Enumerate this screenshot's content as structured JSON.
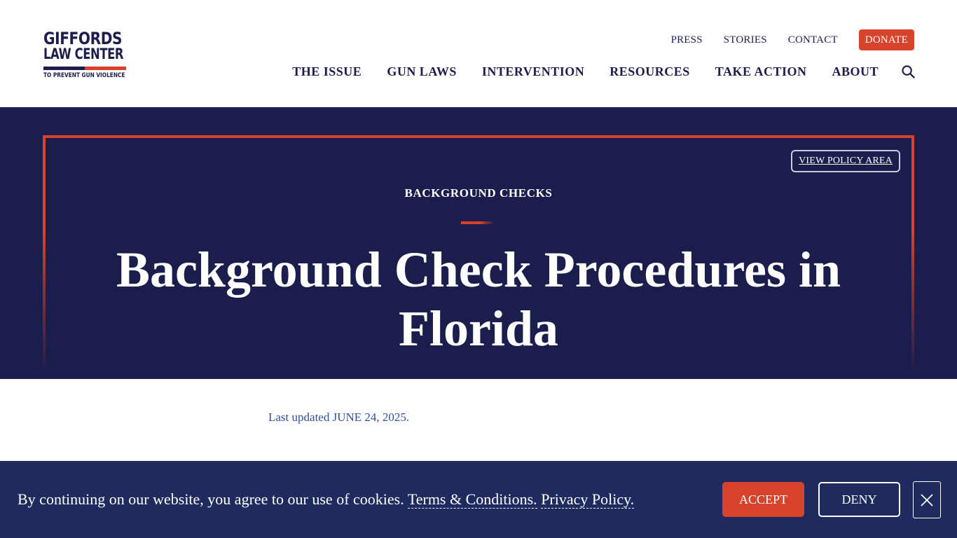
{
  "logo": {
    "line1": "GIFFORDS",
    "line2": "LAW CENTER",
    "tagline": "TO PREVENT GUN VIOLENCE"
  },
  "utility_nav": {
    "press": "PRESS",
    "stories": "STORIES",
    "contact": "CONTACT",
    "donate": "DONATE"
  },
  "main_nav": {
    "items": [
      "THE ISSUE",
      "GUN LAWS",
      "INTERVENTION",
      "RESOURCES",
      "TAKE ACTION",
      "ABOUT"
    ]
  },
  "hero": {
    "policy_button": "VIEW POLICY AREA",
    "eyebrow": "BACKGROUND CHECKS",
    "title": "Background Check Procedures in Florida"
  },
  "content": {
    "updated_prefix": "Last updated ",
    "updated_date": "JUNE 24, 2025",
    "updated_suffix": "."
  },
  "cookie": {
    "text": "By continuing on our website, you agree to our use of cookies.",
    "terms": "Terms & Conditions.",
    "privacy": "Privacy Policy.",
    "accept": "ACCEPT",
    "deny": "DENY"
  },
  "icons": {
    "search": "search-icon",
    "close": "close-icon"
  },
  "colors": {
    "navy": "#1b1d4d",
    "red": "#d6432a",
    "banner": "#1f2a5e",
    "link_blue": "#2f4fa0"
  }
}
